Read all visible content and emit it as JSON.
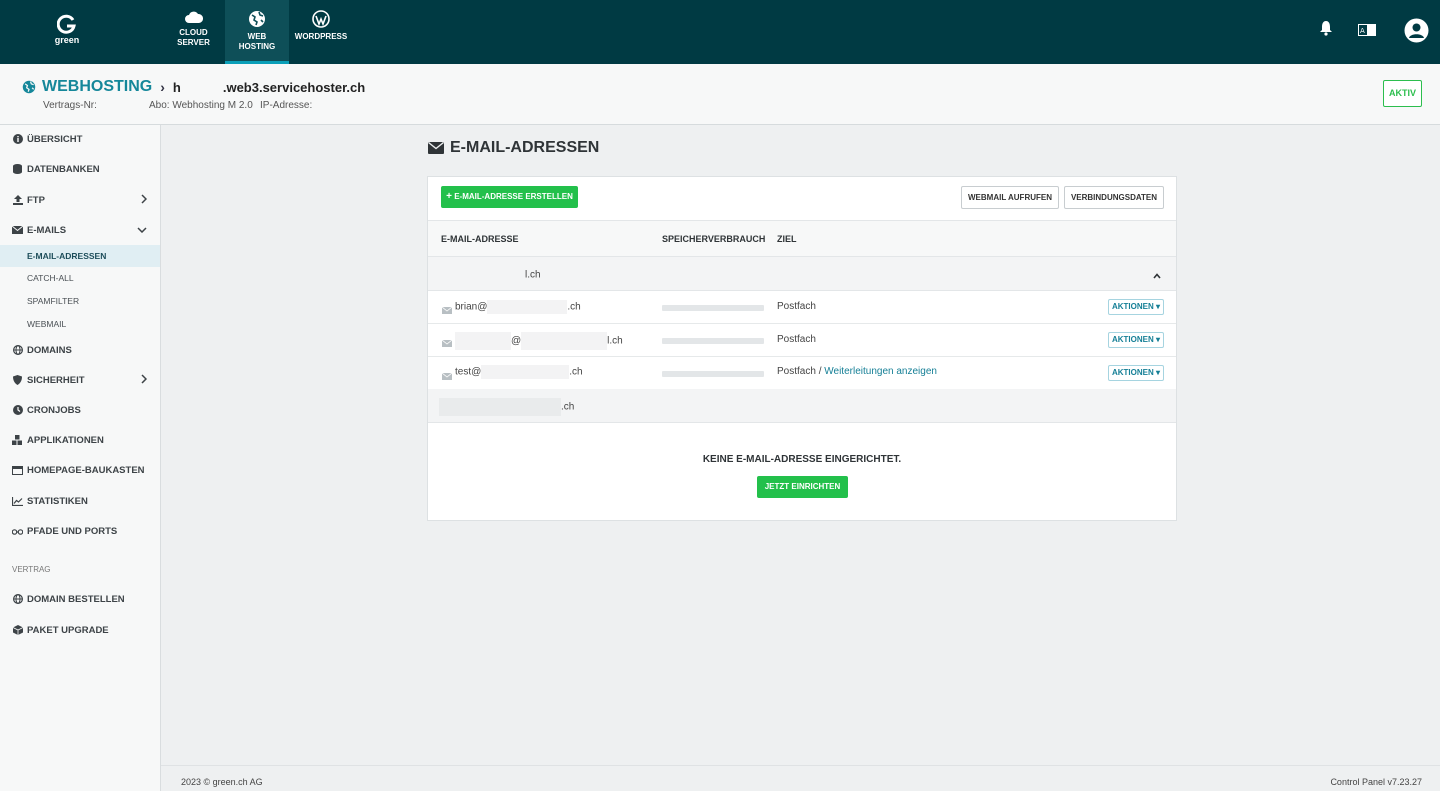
{
  "topbar": {
    "logo_text": "green",
    "nav": [
      {
        "line1": "CLOUD",
        "line2": "SERVER",
        "icon": "cloud-icon"
      },
      {
        "line1": "WEB",
        "line2": "HOSTING",
        "icon": "globe-icon",
        "active": true
      },
      {
        "line1": "WORDPRESS",
        "line2": "",
        "icon": "wordpress-icon"
      }
    ]
  },
  "header": {
    "section": "WEBHOSTING",
    "host_prefix": "h",
    "host_suffix": ".web3.servicehoster.ch",
    "vertrag_label": "Vertrags-Nr:",
    "abo": "Abo: Webhosting M 2.0",
    "ip_label": "IP-Adresse:",
    "status": "AKTIV"
  },
  "sidebar": {
    "items": [
      {
        "label": "ÜBERSICHT"
      },
      {
        "label": "DATENBANKEN"
      },
      {
        "label": "FTP"
      },
      {
        "label": "E-MAILS"
      },
      {
        "label": "DOMAINS"
      },
      {
        "label": "SICHERHEIT"
      },
      {
        "label": "CRONJOBS"
      },
      {
        "label": "APPLIKATIONEN"
      },
      {
        "label": "HOMEPAGE-BAUKASTEN"
      },
      {
        "label": "STATISTIKEN"
      },
      {
        "label": "PFADE UND PORTS"
      }
    ],
    "email_sub": [
      "E-MAIL-ADRESSEN",
      "CATCH-ALL",
      "SPAMFILTER",
      "WEBMAIL"
    ],
    "section_vertrag": "VERTRAG",
    "vertrag_items": [
      {
        "label": "DOMAIN BESTELLEN"
      },
      {
        "label": "PAKET UPGRADE"
      }
    ]
  },
  "main": {
    "title": "E-MAIL-ADRESSEN",
    "create_button": "E-MAIL-ADRESSE ERSTELLEN",
    "webmail_button": "WEBMAIL AUFRUFEN",
    "connection_button": "VERBINDUNGSDATEN",
    "columns": {
      "email": "E-MAIL-ADRESSE",
      "storage": "SPEICHERVERBRAUCH",
      "target": "ZIEL"
    },
    "domain1_suffix": "l.ch",
    "rows": [
      {
        "local": "brian@",
        "suffix": ".ch",
        "target": "Postfach",
        "action": "AKTIONEN"
      },
      {
        "local": "@",
        "suffix": "l.ch",
        "target": "Postfach",
        "action": "AKTIONEN"
      },
      {
        "local": "test@",
        "suffix": ".ch",
        "target": "Postfach",
        "sep": " / ",
        "forward_link": "Weiterleitungen anzeigen",
        "action": "AKTIONEN"
      }
    ],
    "domain2_suffix": ".ch",
    "empty_message": "KEINE E-MAIL-ADRESSE EINGERICHTET.",
    "setup_button": "JETZT EINRICHTEN"
  },
  "footer": {
    "copyright": "2023 © green.ch AG",
    "version": "Control Panel v7.23.27"
  }
}
